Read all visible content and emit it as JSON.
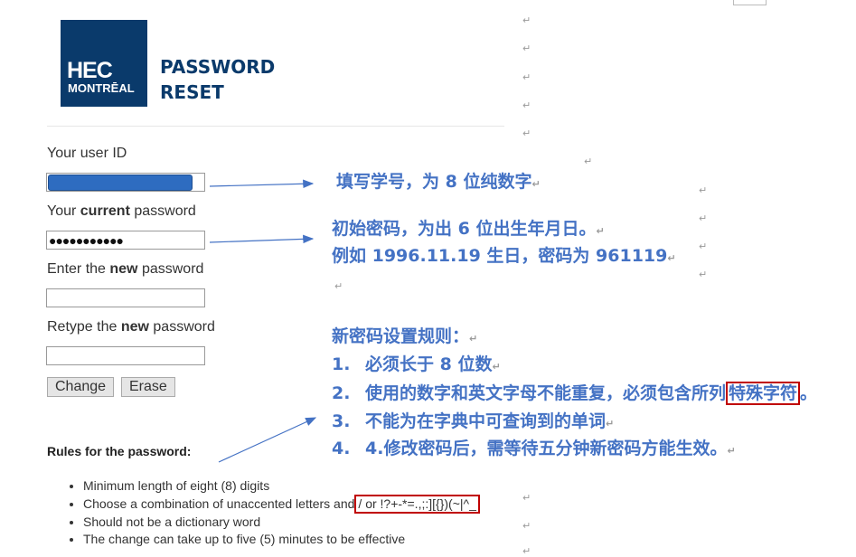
{
  "header": {
    "logo_line1": "HEC",
    "logo_line2": "MONTRĒAL",
    "title_line1": "PASSWORD",
    "title_line2": "RESET"
  },
  "form": {
    "userid_label": "Your user ID",
    "current_prefix": "Your ",
    "current_bold": "current",
    "current_suffix": " password",
    "current_value": "●●●●●●●●●●●",
    "new_prefix": "Enter the ",
    "new_bold": "new",
    "new_suffix": " password",
    "retype_prefix": "Retype the ",
    "retype_bold": "new",
    "retype_suffix": " password",
    "change_button": "Change",
    "erase_button": "Erase"
  },
  "rules": {
    "heading": "Rules for the password:",
    "items": [
      "Minimum length of eight (8) digits",
      "Choose a combination of unaccented letters and",
      "Should not be a dictionary word",
      "The change can take up to five (5) minutes to be effective"
    ],
    "special_chars": "/ or !?+-*=.,;:][{})(~|^_"
  },
  "notes": {
    "userid": "填写学号，为 8 位纯数字",
    "initpwd_line1": "初始密码，为出 6 位出生年月日。",
    "initpwd_line2": "例如 1996.11.19 生日，密码为 961119",
    "rules_title": "新密码设置规则：",
    "rule1_num": "1.",
    "rule1": "必须长于 8 位数",
    "rule2_num": "2.",
    "rule2": "使用的数字和英文字母不能重复，必须包含所列",
    "rule2_highlight": "特殊字符",
    "rule2_end": "。",
    "rule3_num": "3.",
    "rule3": "不能为在字典中可查询到的单词",
    "rule4_num": "4.",
    "rule4": "4.修改密码后，需等待五分钟新密码方能生效。"
  },
  "colors": {
    "brand": "#0a3a6b",
    "annotation": "#4472c4",
    "highlight_border": "#c00000"
  }
}
